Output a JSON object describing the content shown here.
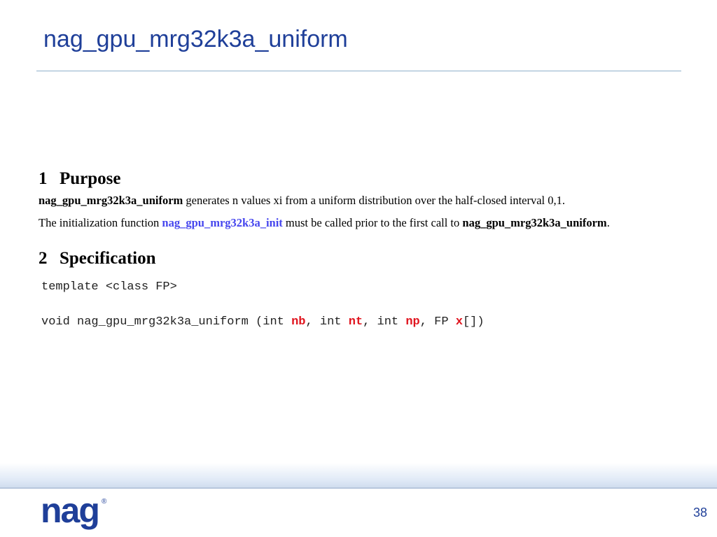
{
  "slide": {
    "title": "nag_gpu_mrg32k3a_uniform",
    "page_number": "38"
  },
  "colors": {
    "title": "#1f3f99",
    "link": "#4646ee",
    "param": "#e0141e"
  },
  "doc": {
    "sections": [
      {
        "number": "1",
        "heading": "Purpose",
        "paragraphs": [
          {
            "func_name": "nag_gpu_mrg32k3a_uniform",
            "text": " generates n values xi from a uniform distribution over the half-closed interval 0,1."
          },
          {
            "lead": "The initialization function ",
            "link_text": "nag_gpu_mrg32k3a_init",
            "middle": " must be called prior to the first call to ",
            "func_name": "nag_gpu_mrg32k3a_uniform",
            "end": "."
          }
        ]
      },
      {
        "number": "2",
        "heading": "Specification",
        "code": {
          "template_line": "template <class FP>",
          "signature_prefix": "void nag_gpu_mrg32k3a_uniform (int ",
          "param_nb": "nb",
          "sep1": ", int ",
          "param_nt": "nt",
          "sep2": ", int ",
          "param_np": "np",
          "sep3": ", FP ",
          "param_x": "x",
          "signature_suffix": "[])"
        }
      }
    ]
  },
  "footer": {
    "logo_text": "nag",
    "logo_mark": "®"
  }
}
